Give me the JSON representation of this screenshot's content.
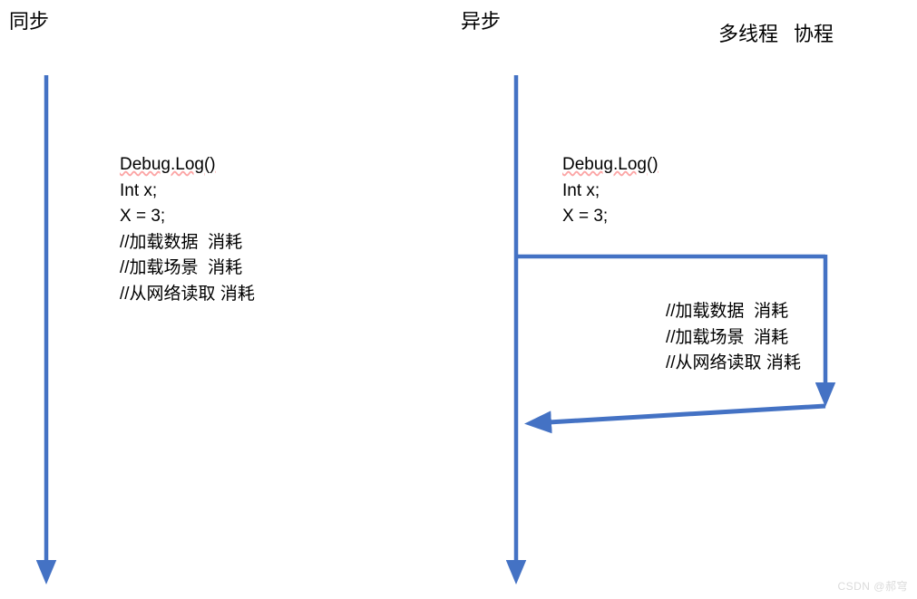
{
  "labels": {
    "sync": "同步",
    "async": "异步",
    "multithread": "多线程",
    "coroutine": "协程"
  },
  "sync_code": {
    "line1": "Debug.Log()",
    "line2": "Int x;",
    "line3": "X = 3;",
    "line4": "//加载数据  消耗",
    "line5": "//加载场景  消耗",
    "line6": "//从网络读取 消耗"
  },
  "async_code_top": {
    "line1": "Debug.Log()",
    "line2": "Int x;",
    "line3": "X = 3;"
  },
  "async_code_branch": {
    "line1": "//加载数据  消耗",
    "line2": "//加载场景  消耗",
    "line3": "//从网络读取 消耗"
  },
  "watermark": "CSDN @郝穹",
  "arrow_color": "#4472C4"
}
